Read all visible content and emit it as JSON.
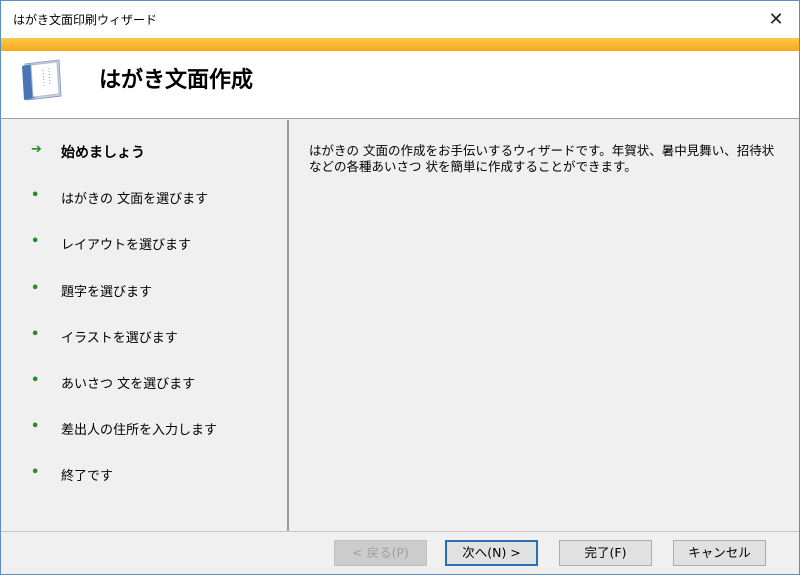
{
  "window": {
    "title": "はがき文面印刷ウィザード",
    "close": "✕"
  },
  "header": {
    "title": "はがき文面作成"
  },
  "steps": [
    {
      "label": "始めましょう",
      "bullet": "➔",
      "current": true
    },
    {
      "label": "はがきの 文面を選びます",
      "bullet": "•"
    },
    {
      "label": "レイアウトを選びます",
      "bullet": "•"
    },
    {
      "label": "題字を選びます",
      "bullet": "•"
    },
    {
      "label": "イラストを選びます",
      "bullet": "•"
    },
    {
      "label": "あいさつ 文を選びます",
      "bullet": "•"
    },
    {
      "label": "差出人の住所を入力します",
      "bullet": "•"
    },
    {
      "label": "終了です",
      "bullet": "•"
    }
  ],
  "description": "はがきの 文面の作成をお手伝いするウィザードです。年賀状、暑中見舞い、招待状などの各種あいさつ 状を簡単に作成することができます。",
  "buttons": {
    "back": "< 戻る(P)",
    "next": "次へ(N) >",
    "finish": "完了(F)",
    "cancel": "キャンセル"
  }
}
